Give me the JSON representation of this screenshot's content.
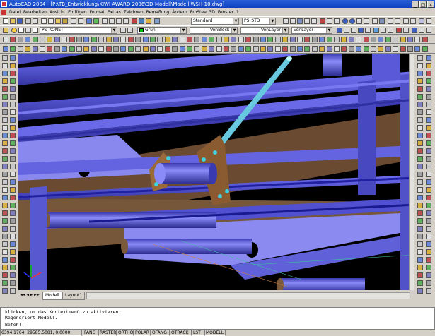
{
  "window": {
    "title": "AutoCAD 2004 - [P:\\TB_Entwicklung\\KIWI AWARD 2006\\3D-Modell\\Modell WSH-10.dwg]",
    "minimize": "_",
    "maximize": "□",
    "close": "×"
  },
  "menu": [
    "Datei",
    "Bearbeiten",
    "Ansicht",
    "Einfügen",
    "Format",
    "Extras",
    "Zeichnen",
    "Bemaßung",
    "Ändern",
    "ProSteel 3D",
    "Fenster",
    "?"
  ],
  "toolbar2": {
    "textstyle": "Standard",
    "dimstyle": "PS_STD"
  },
  "toolbar3": {
    "layer": "PS_KONST",
    "color": "Grün",
    "linetype_block": "VonBlock",
    "linetype_layer": "VonLayer",
    "lineweight_layer": "VonLayer"
  },
  "colors": {
    "beam": "#5a5ae0",
    "plate": "#7a5a3a",
    "rod": "#6ad6e6",
    "ground": "#000000"
  },
  "layout_tabs": {
    "model": "Modell",
    "layout1": "Layout1"
  },
  "command": {
    "line1": "klicken, um das Kontextmenü zu aktivieren.",
    "line2": "Regeneriert Modell.",
    "line3": "Befehl:"
  },
  "status": {
    "coords": "6394.1764, 29585.5081, 0.0000",
    "fang": "FANG",
    "raster": "RASTER",
    "ortho": "ORTHO",
    "polar": "POLAR",
    "ofang": "OFANG",
    "otrack": "OTRACK",
    "lst": "LST",
    "modell": "MODELL"
  }
}
